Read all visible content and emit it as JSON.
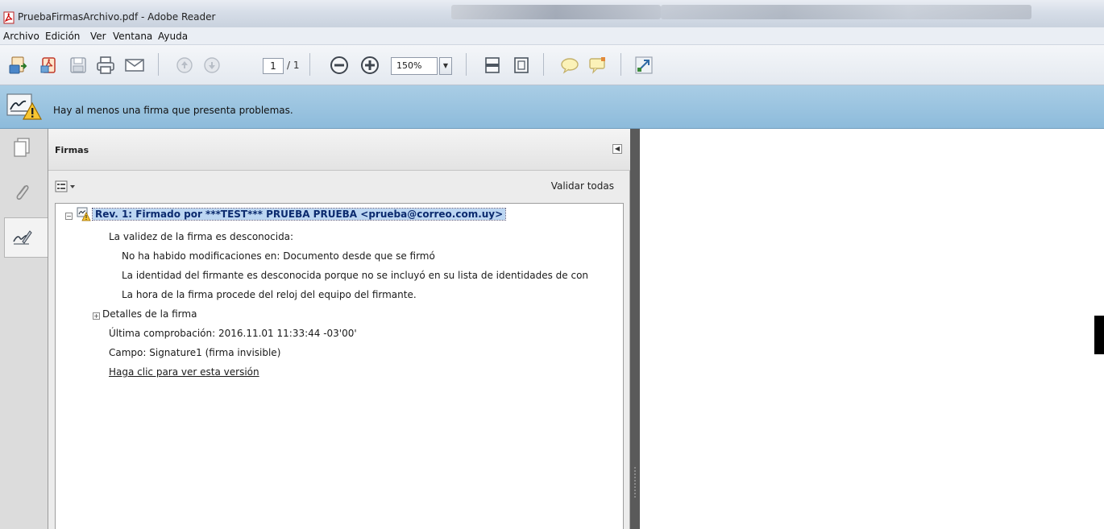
{
  "window": {
    "title": "PruebaFirmasArchivo.pdf - Adobe Reader"
  },
  "menu": {
    "items": [
      "Archivo",
      "Edición",
      "Ver",
      "Ventana",
      "Ayuda"
    ]
  },
  "toolbar": {
    "icons": [
      "create-pdf-icon",
      "open-icon",
      "save-icon",
      "print-icon",
      "email-icon",
      "previous-page-icon",
      "next-page-icon",
      "zoom-out-icon",
      "zoom-in-icon",
      "scroll-mode-icon",
      "fit-page-icon",
      "comment-icon",
      "sticky-note-icon",
      "full-screen-icon"
    ],
    "page_current": "1",
    "page_total": "/ 1",
    "zoom": "150%"
  },
  "warning_bar": {
    "message": "Hay al menos una firma que presenta problemas.",
    "accent": "#8dbbdb"
  },
  "signatures_panel": {
    "title": "Firmas",
    "validate_all": "Validar todas",
    "revision": "Rev. 1: Firmado por ***TEST*** PRUEBA PRUEBA <prueba@correo.com.uy>",
    "validity": "La validez de la firma es desconocida:",
    "details": [
      "No ha habido modificaciones en: Documento desde que se firmó",
      "La identidad del firmante es desconocida porque no se incluyó en su lista de identidades de con",
      "La hora de la firma procede del reloj del equipo del firmante."
    ],
    "signature_details": "Detalles de la firma",
    "last_check": "Última comprobación: 2016.11.01 11:33:44 -03'00'",
    "field": "Campo: Signature1 (firma invisible)",
    "view_version_link": "Haga clic para ver esta versión"
  }
}
